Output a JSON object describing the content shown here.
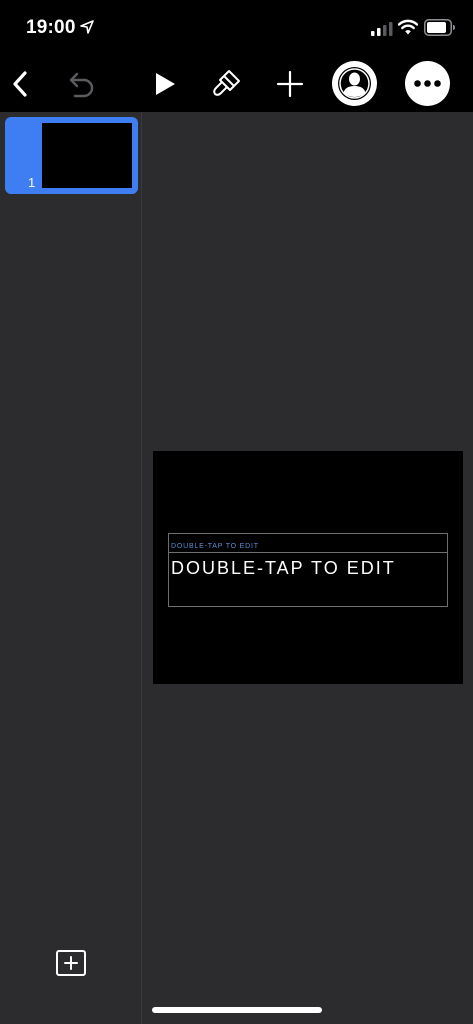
{
  "status_bar": {
    "time": "19:00",
    "icons": [
      "location-arrow-icon",
      "cellular-signal-icon",
      "wifi-icon",
      "battery-icon"
    ]
  },
  "toolbar": {
    "buttons": [
      "back-chevron-icon",
      "undo-icon",
      "play-icon",
      "paintbrush-icon",
      "plus-icon",
      "collaborate-icon",
      "more-icon"
    ]
  },
  "navigator": {
    "slides": [
      {
        "number": "1",
        "selected": true
      }
    ],
    "add_slide_icon": "plus-square-icon"
  },
  "slide": {
    "subtitle": "DOUBLE-TAP TO EDIT",
    "title": "DOUBLE-TAP TO EDIT"
  },
  "colors": {
    "background": "#2c2c2e",
    "bars": "#000000",
    "accent": "#3e7ef2",
    "subtitle": "#5a8ed8"
  }
}
